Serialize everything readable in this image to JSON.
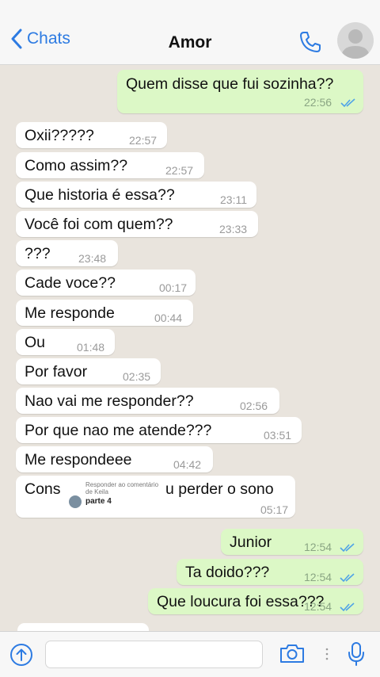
{
  "header": {
    "back_label": "Chats",
    "title": "Amor"
  },
  "messages": [
    {
      "dir": "out",
      "text": "Quem disse que fui sozinha??",
      "time": "22:56",
      "ticks": true
    },
    {
      "dir": "in",
      "text": "Oxii?????",
      "time": "22:57"
    },
    {
      "dir": "in",
      "text": "Como assim??",
      "time": "22:57"
    },
    {
      "dir": "in",
      "text": "Que historia é essa??",
      "time": "23:11"
    },
    {
      "dir": "in",
      "text": "Você foi com quem??",
      "time": "23:33"
    },
    {
      "dir": "in",
      "text": "???",
      "time": "23:48"
    },
    {
      "dir": "in",
      "text": "Cade voce??",
      "time": "00:17"
    },
    {
      "dir": "in",
      "text": "Me responde",
      "time": "00:44"
    },
    {
      "dir": "in",
      "text": "Ou",
      "time": "01:48"
    },
    {
      "dir": "in",
      "text": "Por favor",
      "time": "02:35"
    },
    {
      "dir": "in",
      "text": "Nao vai me responder??",
      "time": "02:56"
    },
    {
      "dir": "in",
      "text": "Por que nao me atende???",
      "time": "03:51"
    },
    {
      "dir": "in",
      "text": "Me respondeee",
      "time": "04:42"
    },
    {
      "dir": "in",
      "text_left": "Cons",
      "text_right": "u perder o sono",
      "time": "05:17"
    },
    {
      "dir": "out",
      "text": "Junior",
      "time": "12:54",
      "ticks": true
    },
    {
      "dir": "out",
      "text": "Ta doido???",
      "time": "12:54",
      "ticks": true
    },
    {
      "dir": "out",
      "text": "Que loucura foi essa???",
      "time": "12:54",
      "ticks": true
    }
  ],
  "reply_overlay": {
    "caption": "Responder ao comentário de Keila",
    "label": "parte 4"
  },
  "footer": {
    "input_value": ""
  }
}
